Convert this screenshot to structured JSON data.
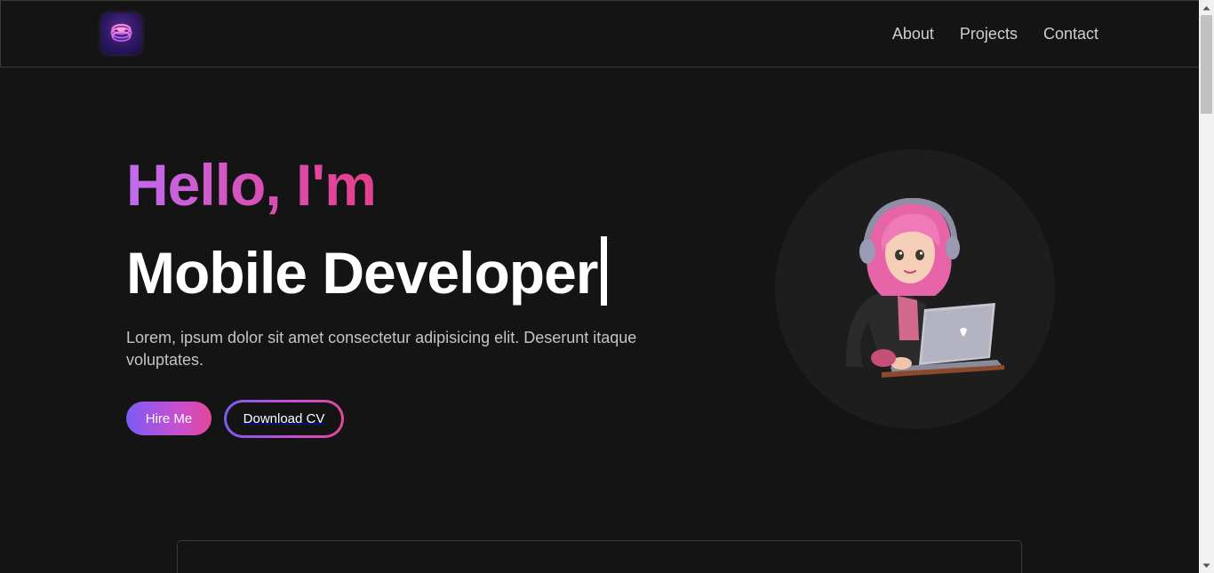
{
  "nav": {
    "items": [
      "About",
      "Projects",
      "Contact"
    ]
  },
  "hero": {
    "greeting": "Hello, I'm",
    "role": "Mobile Developer",
    "description": "Lorem, ipsum dolor sit amet consectetur adipisicing elit. Deserunt itaque voluptates.",
    "hire_label": "Hire Me",
    "cv_label": "Download CV"
  },
  "colors": {
    "background": "#141414",
    "gradient_start": "#7b5cf5",
    "gradient_end": "#e2489a",
    "border": "#3a3a3a"
  },
  "icons": {
    "logo": "layered-stack-logo",
    "avatar": "girl-with-laptop-avatar"
  }
}
